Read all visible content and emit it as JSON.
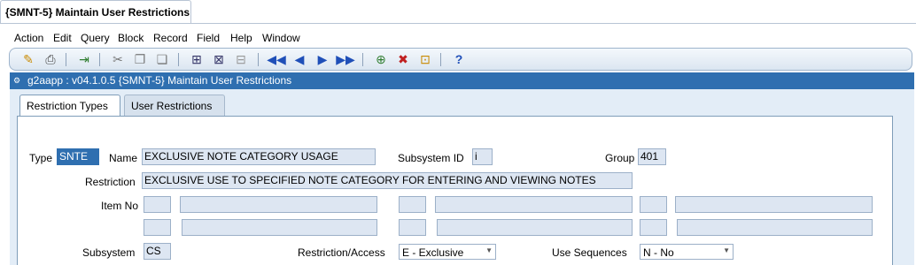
{
  "window": {
    "tab_title": "{SMNT-5} Maintain User Restrictions"
  },
  "menu": [
    "Action",
    "Edit",
    "Query",
    "Block",
    "Record",
    "Field",
    "Help",
    "Window"
  ],
  "toolbar": {
    "icons": [
      "save-icon",
      "print-icon",
      "exit-icon",
      "cut-icon",
      "copy-icon",
      "paste-icon",
      "query-enter-icon",
      "query-execute-icon",
      "query-cancel-icon",
      "first-record-icon",
      "previous-record-icon",
      "next-record-icon",
      "last-record-icon",
      "insert-record-icon",
      "delete-record-icon",
      "lock-record-icon",
      "help-icon"
    ]
  },
  "titlebar": {
    "title": "g2aapp : v04.1.0.5  {SMNT-5} Maintain User Restrictions"
  },
  "tabs": [
    {
      "label": "Restriction Types"
    },
    {
      "label": "User Restrictions"
    }
  ],
  "form": {
    "type_label": "Type",
    "type_value": "SNTE",
    "name_label": "Name",
    "name_value": "EXCLUSIVE NOTE CATEGORY USAGE",
    "subsystem_id_label": "Subsystem ID",
    "subsystem_id_value": "i",
    "group_label": "Group",
    "group_value": "401",
    "restriction_label": "Restriction",
    "restriction_value": "EXCLUSIVE USE TO SPECIFIED NOTE CATEGORY FOR ENTERING AND VIEWING NOTES",
    "item_no_label": "Item No",
    "subsystem_label": "Subsystem",
    "subsystem_value": "CS",
    "access_label": "Restriction/Access",
    "access_value": "E - Exclusive",
    "sequences_label": "Use Sequences",
    "sequences_value": "N - No"
  }
}
